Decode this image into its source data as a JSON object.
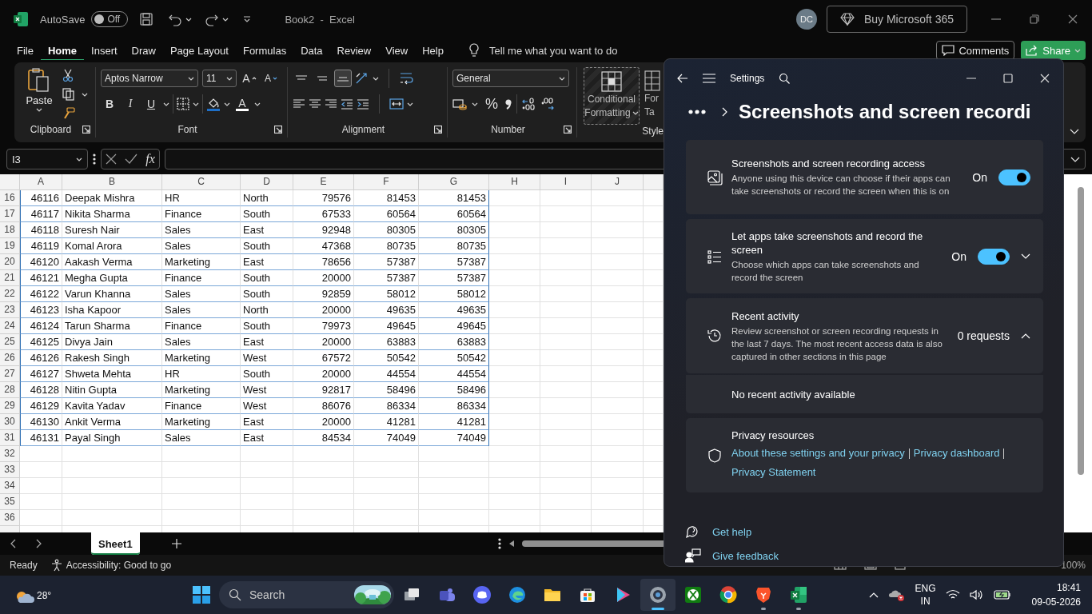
{
  "excel": {
    "title_bar": {
      "autosave_label": "AutoSave",
      "autosave": {
        "on": false,
        "label": "Off"
      },
      "title": "Book2  -  Excel",
      "avatar": "DC",
      "buy_button": "Buy Microsoft 365"
    },
    "menu_tabs": [
      {
        "label": "File",
        "selected": false
      },
      {
        "label": "Home",
        "selected": true
      },
      {
        "label": "Insert",
        "selected": false
      },
      {
        "label": "Draw",
        "selected": false
      },
      {
        "label": "Page Layout",
        "selected": false
      },
      {
        "label": "Formulas",
        "selected": false
      },
      {
        "label": "Data",
        "selected": false
      },
      {
        "label": "Review",
        "selected": false
      },
      {
        "label": "View",
        "selected": false
      },
      {
        "label": "Help",
        "selected": false
      }
    ],
    "tell_me": "Tell me what you want to do",
    "comments_button": "Comments",
    "share_button": "Share",
    "ribbon": {
      "clipboard": {
        "paste": "Paste",
        "label": "Clipboard"
      },
      "font": {
        "name": "Aptos Narrow",
        "size": "11",
        "grow": "A",
        "shrink": "A",
        "bold": "B",
        "italic": "I",
        "underline": "U",
        "font_color": "A",
        "label": "Font"
      },
      "alignment": {
        "vertical": [
          {
            "selected": false
          },
          {
            "selected": false
          },
          {
            "selected": true
          }
        ],
        "label": "Alignment"
      },
      "number": {
        "format": "General",
        "percent": "%",
        "label": "Number"
      },
      "styles": {
        "conditional_formatting": [
          "Conditional",
          "Formatting"
        ],
        "format_as_table": [
          "For",
          "Ta"
        ],
        "label": "Style"
      }
    },
    "formula_bar": {
      "name_box": "I3",
      "fx": "fx"
    },
    "sheet": {
      "columns": [
        "A",
        "B",
        "C",
        "D",
        "E",
        "F",
        "G",
        "H",
        "I",
        "J"
      ],
      "rows": [
        {
          "n": "16",
          "cells": [
            "46116",
            "Deepak Mishra",
            "HR",
            "North",
            "79576",
            "81453",
            "81453"
          ]
        },
        {
          "n": "17",
          "cells": [
            "46117",
            "Nikita Sharma",
            "Finance",
            "South",
            "67533",
            "60564",
            "60564"
          ]
        },
        {
          "n": "18",
          "cells": [
            "46118",
            "Suresh Nair",
            "Sales",
            "East",
            "92948",
            "80305",
            "80305"
          ]
        },
        {
          "n": "19",
          "cells": [
            "46119",
            "Komal Arora",
            "Sales",
            "South",
            "47368",
            "80735",
            "80735"
          ]
        },
        {
          "n": "20",
          "cells": [
            "46120",
            "Aakash Verma",
            "Marketing",
            "East",
            "78656",
            "57387",
            "57387"
          ]
        },
        {
          "n": "21",
          "cells": [
            "46121",
            "Megha Gupta",
            "Finance",
            "South",
            "20000",
            "57387",
            "57387"
          ]
        },
        {
          "n": "22",
          "cells": [
            "46122",
            "Varun Khanna",
            "Sales",
            "South",
            "92859",
            "58012",
            "58012"
          ]
        },
        {
          "n": "23",
          "cells": [
            "46123",
            "Isha Kapoor",
            "Sales",
            "North",
            "20000",
            "49635",
            "49635"
          ]
        },
        {
          "n": "24",
          "cells": [
            "46124",
            "Tarun Sharma",
            "Finance",
            "South",
            "79973",
            "49645",
            "49645"
          ]
        },
        {
          "n": "25",
          "cells": [
            "46125",
            "Divya Jain",
            "Sales",
            "East",
            "20000",
            "63883",
            "63883"
          ]
        },
        {
          "n": "26",
          "cells": [
            "46126",
            "Rakesh Singh",
            "Marketing",
            "West",
            "67572",
            "50542",
            "50542"
          ]
        },
        {
          "n": "27",
          "cells": [
            "46127",
            "Shweta Mehta",
            "HR",
            "South",
            "20000",
            "44554",
            "44554"
          ]
        },
        {
          "n": "28",
          "cells": [
            "46128",
            "Nitin Gupta",
            "Marketing",
            "West",
            "92817",
            "58496",
            "58496"
          ]
        },
        {
          "n": "29",
          "cells": [
            "46129",
            "Kavita Yadav",
            "Finance",
            "West",
            "86076",
            "86334",
            "86334"
          ]
        },
        {
          "n": "30",
          "cells": [
            "46130",
            "Ankit Verma",
            "Marketing",
            "East",
            "20000",
            "41281",
            "41281"
          ]
        },
        {
          "n": "31",
          "cells": [
            "46131",
            "Payal Singh",
            "Sales",
            "East",
            "84534",
            "74049",
            "74049"
          ]
        }
      ],
      "empty_rows": [
        "32",
        "33",
        "34",
        "35",
        "36"
      ]
    },
    "sheet_tabs": [
      {
        "label": "Sheet1",
        "selected": true
      }
    ],
    "status_bar": {
      "ready": "Ready",
      "accessibility": "Accessibility: Good to go",
      "zoom": "100%"
    }
  },
  "settings": {
    "title": "Settings",
    "heading": "Screenshots and screen recordi",
    "cards": [
      {
        "kind": "toggle",
        "title": "Screenshots and screen recording access",
        "description": "Anyone using this device can choose if their apps can take screenshots or record the screen when this is on",
        "toggle": {
          "label": "On",
          "on": true
        }
      },
      {
        "kind": "toggle",
        "title": "Let apps take screenshots and record the screen",
        "description": "Choose which apps can take screenshots and record the screen",
        "toggle": {
          "label": "On",
          "on": true
        },
        "expanded": false
      },
      {
        "kind": "activity",
        "title": "Recent activity",
        "description": "Review screenshot or screen recording requests in the last 7 days. The most recent access data is also captured in other sections in this page",
        "count": "0 requests",
        "expanded": true,
        "detail": "No recent activity available"
      },
      {
        "kind": "links",
        "title": "Privacy resources",
        "links": [
          "About these settings and your privacy",
          "Privacy dashboard",
          "Privacy Statement"
        ]
      }
    ],
    "footer_links": [
      "Get help",
      "Give feedback"
    ]
  },
  "taskbar": {
    "weather": "28°",
    "search": "Search",
    "apps": [
      {
        "running": false,
        "active": false
      },
      {
        "running": false,
        "active": false
      },
      {
        "running": false,
        "active": false
      },
      {
        "running": false,
        "active": false
      },
      {
        "running": false,
        "active": false
      },
      {
        "running": false,
        "active": false
      },
      {
        "running": false,
        "active": false
      },
      {
        "running": true,
        "active": true
      },
      {
        "running": false,
        "active": false
      },
      {
        "running": false,
        "active": false
      },
      {
        "running": true,
        "active": false
      },
      {
        "running": true,
        "active": false
      }
    ],
    "language": [
      "ENG",
      "IN"
    ],
    "time": "18:41",
    "date": "09-05-2026"
  }
}
